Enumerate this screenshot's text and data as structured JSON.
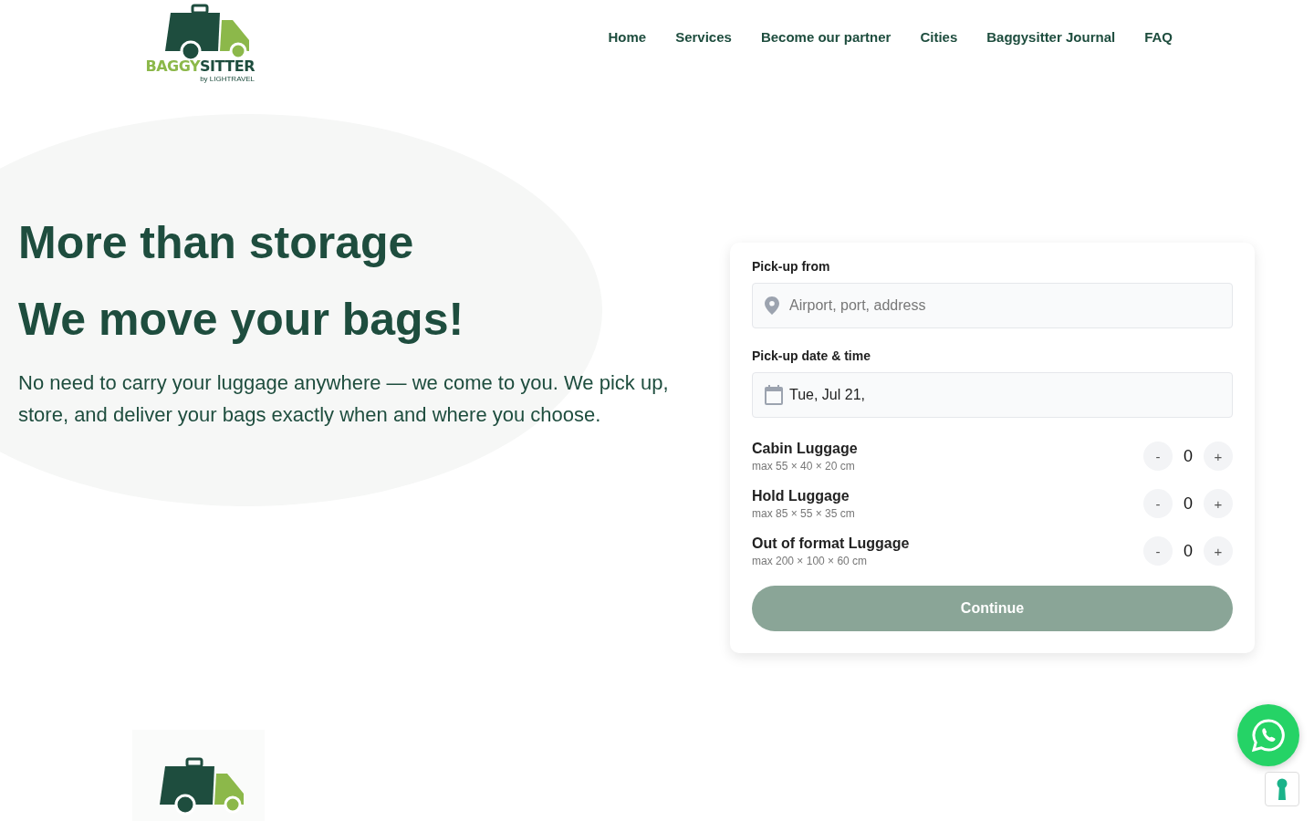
{
  "header": {
    "logo": {
      "brand_light": "BAGGY",
      "brand_dark": "SITTER",
      "tagline": "by LIGHTRAVEL"
    },
    "nav": [
      {
        "label": "Home"
      },
      {
        "label": "Services"
      },
      {
        "label": "Become our partner"
      },
      {
        "label": "Cities"
      },
      {
        "label": "Baggysitter Journal"
      },
      {
        "label": "FAQ"
      }
    ]
  },
  "hero": {
    "title": "More than storage",
    "subtitle": "We move your bags!",
    "description": "No need to carry your luggage anywhere — we come to you. We pick up, store, and deliver your bags exactly when and where you choose."
  },
  "booking": {
    "pickup_label": "Pick-up from",
    "pickup_placeholder": "Airport, port, address",
    "date_label": "Pick-up date & time",
    "date_value": "Tue, Jul 21,",
    "luggage": [
      {
        "name": "Cabin Luggage",
        "size": "max 55 × 40 × 20 cm",
        "minus": "-",
        "count": "0",
        "plus": "+"
      },
      {
        "name": "Hold Luggage",
        "size": "max 85 × 55 × 35 cm",
        "minus": "-",
        "count": "0",
        "plus": "+"
      },
      {
        "name": "Out of format Luggage",
        "size": "max 200 × 100 × 60 cm",
        "minus": "-",
        "count": "0",
        "plus": "+"
      }
    ],
    "continue": {
      "label": "Continue",
      "disabled": true
    }
  }
}
